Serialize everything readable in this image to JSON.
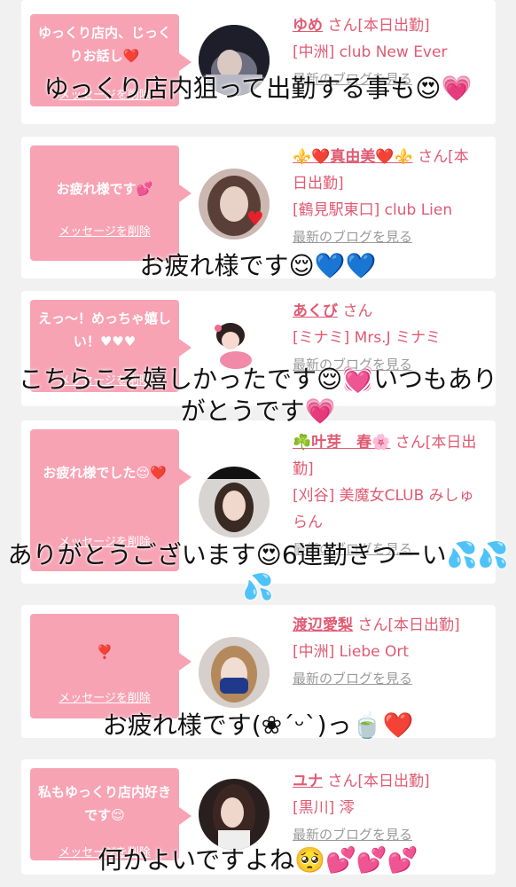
{
  "cards": [
    {
      "bubble": "ゆっくり店内、じっくりお話し❤️",
      "delete_label": "メッセージを削除",
      "name": "ゆめ",
      "san_suffix": "さん[本日出勤]",
      "shop": "[中洲] club New Ever",
      "blog_label": "最新のブログを見る",
      "overlay": "ゆっくり店内狙って出勤する事も😍💗"
    },
    {
      "bubble": "お疲れ様です💕",
      "delete_label": "メッセージを削除",
      "name": "⚜️❤️真由美❤️⚜️",
      "san_suffix": "さん[本日出勤]",
      "shop": "[鶴見駅東口] club Lien",
      "blog_label": "最新のブログを見る",
      "overlay": "お疲れ様です😌💙💙"
    },
    {
      "bubble": "えっ〜！めっちゃ嬉しい！♥♥♥",
      "delete_label": "メッセージを削除",
      "name": "あくび",
      "san_suffix": "さん",
      "shop": "[ミナミ] Mrs.J ミナミ",
      "blog_label": "最新のブログを見る",
      "overlay": "こちらこそ嬉しかったです😌💓いつもありがとうです💗"
    },
    {
      "bubble": "お疲れ様でした😌❤️",
      "delete_label": "メッセージを削除",
      "name": "☘️叶芽　春🌸",
      "san_suffix": "さん[本日出勤]",
      "shop": "[刈谷] 美魔女CLUB みしゅらん",
      "blog_label": "最新のブログを見る",
      "overlay": "ありがとうございます😍6連勤きつーい💦💦💦"
    },
    {
      "bubble": "❣️",
      "delete_label": "メッセージを削除",
      "name": "渡辺愛梨",
      "san_suffix": "さん[本日出勤]",
      "shop": "[中洲] Liebe Ort",
      "blog_label": "最新のブログを見る",
      "overlay": "お疲れ様です(❀ˊᵕˋ)っ🍵❤️"
    },
    {
      "bubble": "私もゆっくり店内好きです😌",
      "delete_label": "メッセージを削除",
      "name": "ユナ",
      "san_suffix": "さん[本日出勤]",
      "shop": "[黒川] 澪",
      "blog_label": "最新のブログを見る",
      "overlay": "何かよいですよね🥺💕💕💕"
    }
  ],
  "colors": {
    "bubble": "#f7a3b4",
    "name": "#e05a73",
    "background": "#f1f1f1"
  }
}
